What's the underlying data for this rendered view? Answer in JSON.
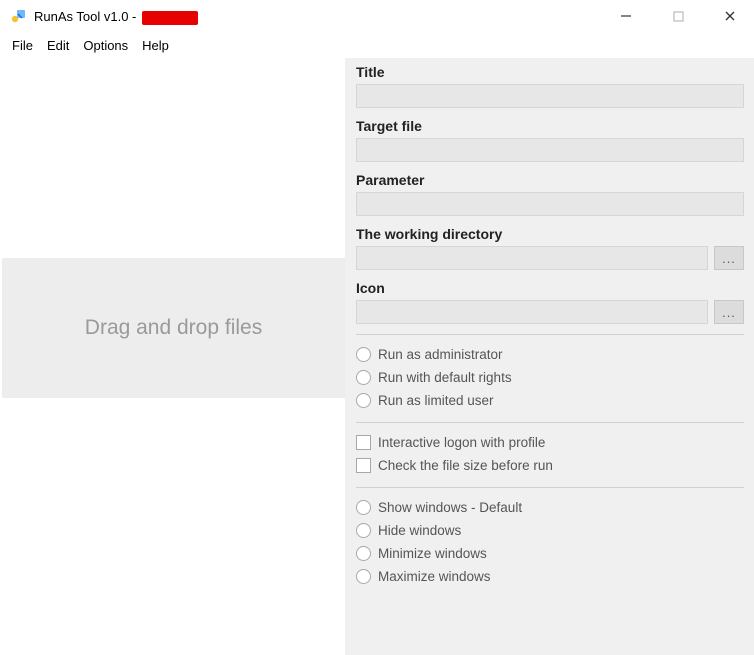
{
  "window": {
    "title": "RunAs Tool v1.0 -",
    "redacted_after_title": true,
    "controls": {
      "minimize": "–",
      "maximize": "▢",
      "close": "✕"
    }
  },
  "menubar": [
    "File",
    "Edit",
    "Options",
    "Help"
  ],
  "left": {
    "dropzone_text": "Drag and drop files"
  },
  "right": {
    "fields": {
      "title_label": "Title",
      "title_value": "",
      "target_label": "Target file",
      "target_value": "",
      "param_label": "Parameter",
      "param_value": "",
      "workdir_label": "The working directory",
      "workdir_value": "",
      "workdir_browse": "...",
      "icon_label": "Icon",
      "icon_value": "",
      "icon_browse": "..."
    },
    "run_mode": {
      "admin": "Run as administrator",
      "default": "Run with default rights",
      "limited": "Run as limited user"
    },
    "checks": {
      "interactive": "Interactive logon with profile",
      "checksize": "Check the file size before run"
    },
    "show_mode": {
      "show": "Show windows - Default",
      "hide": "Hide windows",
      "min": "Minimize windows",
      "max": "Maximize windows"
    }
  }
}
